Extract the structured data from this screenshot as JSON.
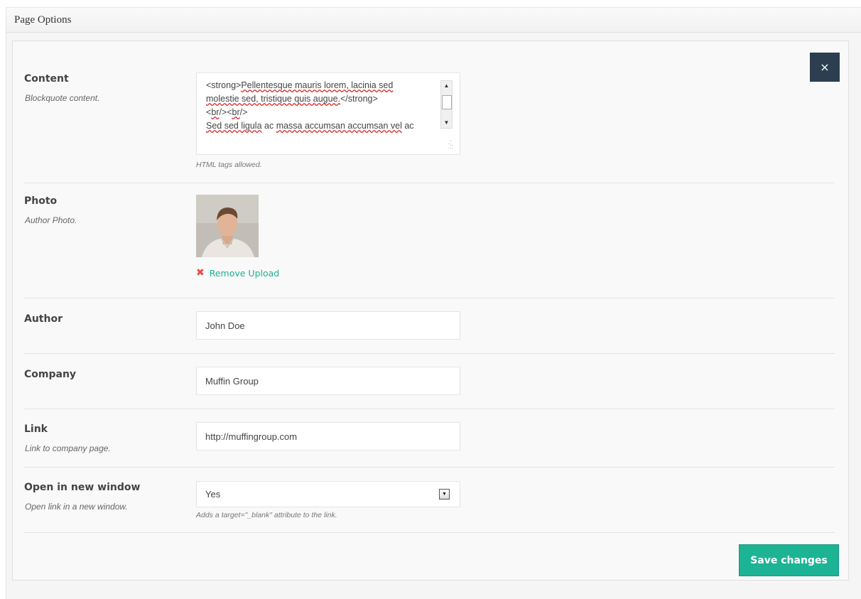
{
  "postbox": {
    "title": "Page Options"
  },
  "close_label": "×",
  "content": {
    "label": "Content",
    "desc": "Blockquote content.",
    "lines": [
      [
        "<strong>",
        "Pellentesque mauris lorem, lacinia sed"
      ],
      [
        "molestie sed, tristique quis augue.",
        "</strong>"
      ],
      [
        "<",
        "br",
        "/><",
        "br",
        "/>"
      ],
      [
        "Sed sed ligula",
        " ac ",
        "massa accumsan accumsan vel",
        " ac"
      ]
    ],
    "hint": "HTML tags allowed."
  },
  "photo": {
    "label": "Photo",
    "desc": "Author Photo.",
    "remove_label": "Remove Upload"
  },
  "author": {
    "label": "Author",
    "value": "John Doe"
  },
  "company": {
    "label": "Company",
    "value": "Muffin Group"
  },
  "link": {
    "label": "Link",
    "desc": "Link to company page.",
    "value": "http://muffingroup.com"
  },
  "new_window": {
    "label": "Open in new window",
    "desc": "Open link in a new window.",
    "value": "Yes",
    "hint": "Adds a target=\"_blank\" attribute to the link."
  },
  "save_label": "Save changes",
  "colors": {
    "accent": "#1cb495",
    "close_bg": "#2c3e50",
    "remove_x": "#e54d42"
  }
}
